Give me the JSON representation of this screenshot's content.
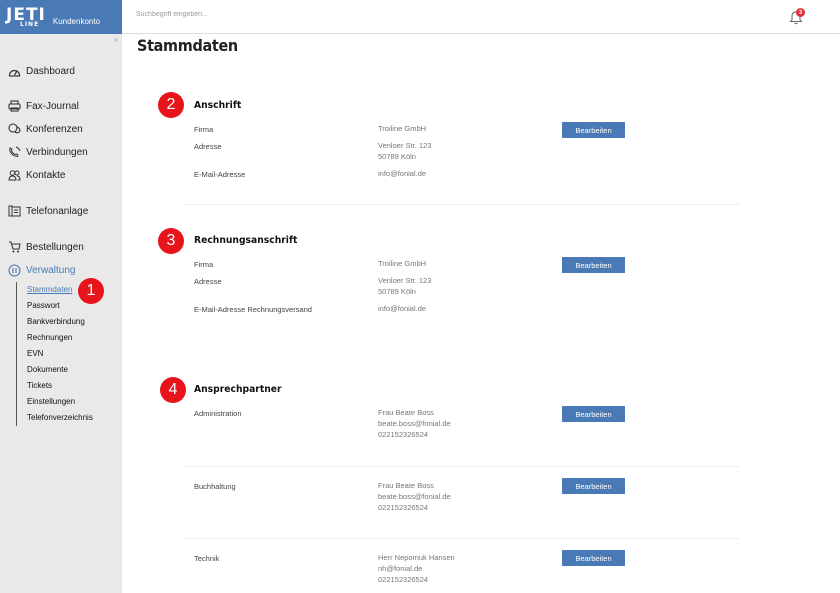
{
  "brand": {
    "logo_top": "JETI",
    "logo_bottom": "LINE",
    "label": "Kundenkonto"
  },
  "sidebar": {
    "collapse_glyph": "«",
    "items": [
      {
        "label": "Dashboard",
        "icon": "dashboard-icon"
      },
      {
        "label": "Fax-Journal",
        "icon": "fax-icon"
      },
      {
        "label": "Konferenzen",
        "icon": "conference-icon"
      },
      {
        "label": "Verbindungen",
        "icon": "phone-icon"
      },
      {
        "label": "Kontakte",
        "icon": "contacts-icon"
      },
      {
        "label": "Telefonanlage",
        "icon": "phone-system-icon"
      },
      {
        "label": "Bestellungen",
        "icon": "cart-icon"
      },
      {
        "label": "Verwaltung",
        "icon": "settings-circle-icon"
      }
    ],
    "subitems": [
      "Stammdaten",
      "Passwort",
      "Bankverbindung",
      "Rechnungen",
      "EVN",
      "Dokumente",
      "Tickets",
      "Einstellungen",
      "Telefonverzeichnis"
    ]
  },
  "topbar": {
    "search_placeholder": "Suchbegriff eingeben...",
    "notification_count": "3"
  },
  "page": {
    "title": "Stammdaten"
  },
  "anschrift": {
    "title": "Anschrift",
    "rows": [
      {
        "label": "Firma",
        "value": "Troiline GmbH"
      },
      {
        "label": "Adresse",
        "value": "Venloer Str. 123\n50789 Köln"
      },
      {
        "label": "E-Mail-Adresse",
        "value": "info@fonial.de"
      }
    ],
    "button": "Bearbeiten"
  },
  "rechnungsanschrift": {
    "title": "Rechnungsanschrift",
    "rows": [
      {
        "label": "Firma",
        "value": "Troiline GmbH"
      },
      {
        "label": "Adresse",
        "value": "Venloer Str. 123\n50789 Köln"
      },
      {
        "label": "E-Mail-Adresse Rechnungsversand",
        "value": "info@fonial.de"
      }
    ],
    "button": "Bearbeiten"
  },
  "ansprechpartner": {
    "title": "Ansprechpartner",
    "contacts": [
      {
        "role": "Administration",
        "details": "Frau Beate Boss\nbeate.boss@fonial.de\n022152326524",
        "button": "Bearbeiten"
      },
      {
        "role": "Buchhaltung",
        "details": "Frau Beate Boss\nbeate.boss@fonial.de\n022152326524",
        "button": "Bearbeiten"
      },
      {
        "role": "Technik",
        "details": "Herr Nepomuk Hansen\nnh@fonial.de\n022152326524",
        "button": "Bearbeiten"
      }
    ]
  },
  "markers": [
    "1",
    "2",
    "3",
    "4"
  ],
  "colors": {
    "brand_blue": "#4a7ab5",
    "marker_red": "#e8141c",
    "badge_red": "#d9303a"
  }
}
